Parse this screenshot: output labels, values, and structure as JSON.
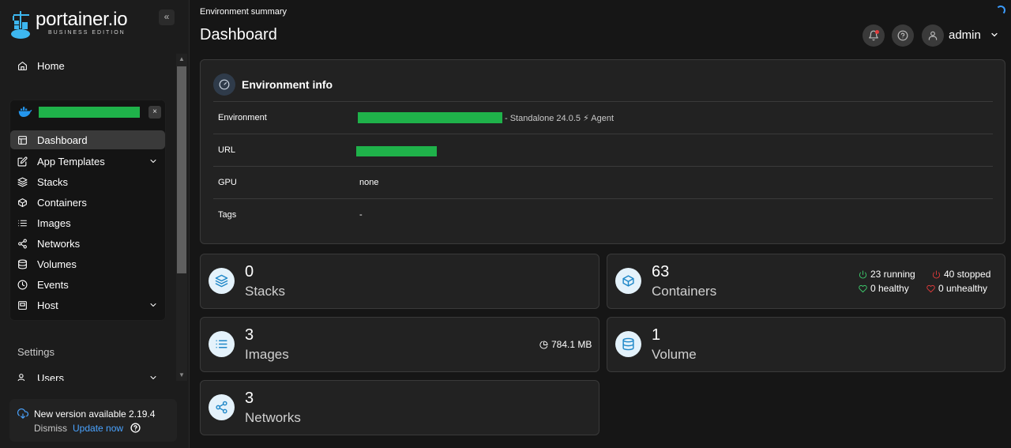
{
  "brand": {
    "title": "portainer.io",
    "subtitle": "BUSINESS EDITION"
  },
  "sidebar": {
    "collapse_glyph": "«",
    "home": {
      "label": "Home",
      "icon": "home-icon"
    },
    "environment": {
      "close_glyph": "×"
    },
    "items": [
      {
        "label": "Dashboard",
        "icon": "dashboard-icon",
        "active": true
      },
      {
        "label": "App Templates",
        "icon": "edit-icon",
        "expandable": true
      },
      {
        "label": "Stacks",
        "icon": "layers-icon"
      },
      {
        "label": "Containers",
        "icon": "box-icon"
      },
      {
        "label": "Images",
        "icon": "list-icon"
      },
      {
        "label": "Networks",
        "icon": "share-icon"
      },
      {
        "label": "Volumes",
        "icon": "database-icon"
      },
      {
        "label": "Events",
        "icon": "clock-icon"
      },
      {
        "label": "Host",
        "icon": "host-icon",
        "expandable": true
      }
    ],
    "settings_label": "Settings",
    "users_label": "Users",
    "update": {
      "title": "New version available 2.19.4",
      "dismiss": "Dismiss",
      "update_now": "Update now"
    }
  },
  "header": {
    "breadcrumb": "Environment summary",
    "title": "Dashboard",
    "user": "admin"
  },
  "env_info": {
    "title": "Environment info",
    "rows": [
      {
        "key": "Environment",
        "value": "",
        "extra": "- Standalone 24.0.5",
        "agent": "Agent"
      },
      {
        "key": "URL",
        "value": ""
      },
      {
        "key": "GPU",
        "value": "none"
      },
      {
        "key": "Tags",
        "value": "-"
      }
    ]
  },
  "stats": {
    "stacks": {
      "count": "0",
      "label": "Stacks"
    },
    "containers": {
      "count": "63",
      "label": "Containers",
      "running": "23 running",
      "stopped": "40 stopped",
      "healthy": "0 healthy",
      "unhealthy": "0 unhealthy"
    },
    "images": {
      "count": "3",
      "label": "Images",
      "size": "784.1 MB"
    },
    "volumes": {
      "count": "1",
      "label": "Volume"
    },
    "networks": {
      "count": "3",
      "label": "Networks"
    }
  },
  "colors": {
    "accent": "#1e87c8",
    "link": "#4aa3ff",
    "redacted": "#1fb24a",
    "running": "#3ecf6e",
    "stopped": "#e23b3b"
  }
}
